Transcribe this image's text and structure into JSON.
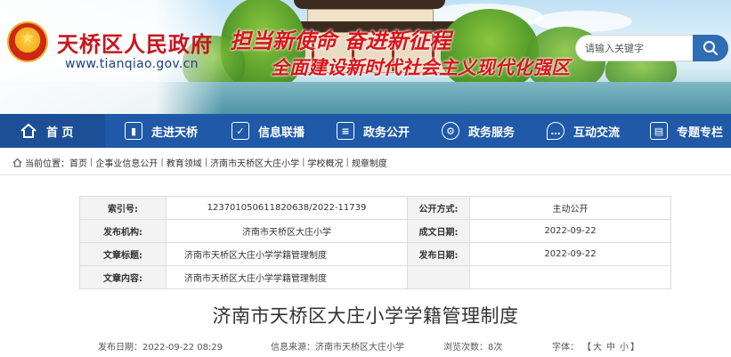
{
  "header": {
    "site_title": "天桥区人民政府",
    "site_url": "www.tianqiao.gov.cn",
    "slogan_line1": "担当新使命  奋进新征程",
    "slogan_line2": "全面建设新时代社会主义现代化强区",
    "search_placeholder": "请输入关键字"
  },
  "nav": {
    "items": [
      {
        "label": "首  页",
        "icon": "home-icon"
      },
      {
        "label": "走进天桥",
        "icon": "bookmark-icon"
      },
      {
        "label": "信息联播",
        "icon": "broadcast-icon"
      },
      {
        "label": "政务公开",
        "icon": "document-icon"
      },
      {
        "label": "政务服务",
        "icon": "service-icon"
      },
      {
        "label": "互动交流",
        "icon": "chat-icon"
      },
      {
        "label": "专题专栏",
        "icon": "topic-icon"
      }
    ]
  },
  "breadcrumb": {
    "prefix": "当前位置：",
    "items": [
      "首页",
      "企事业信息公开",
      "教育领域",
      "济南市天桥区大庄小学",
      "学校概况",
      "规章制度"
    ]
  },
  "info_table": {
    "index_label": "索引号:",
    "index_value": "123701050611820638/2022-11739",
    "open_mode_label": "公开方式:",
    "open_mode_value": "主动公开",
    "publisher_label": "发布机构:",
    "publisher_value": "济南市天桥区大庄小学",
    "created_label": "成文日期:",
    "created_value": "2022-09-22",
    "article_title_label": "文章标题:",
    "article_title_value": "济南市天桥区大庄小学学籍管理制度",
    "published_label": "发布日期:",
    "published_value": "2022-09-22",
    "article_content_label": "文章内容:",
    "article_content_value": "济南市天桥区大庄小学学籍管理制度"
  },
  "article": {
    "title": "济南市天桥区大庄小学学籍管理制度",
    "publish_date": "发布日期：2022-09-22 08:29",
    "source": "信息来源：济南市天桥区大庄小学",
    "views": "浏览次数：8次",
    "font_size_label": "字体：",
    "font_large": "大",
    "font_medium": "中",
    "font_small": "小"
  },
  "colors": {
    "nav_bg": "#1f59a8",
    "title_red": "#c8161d",
    "search_button": "#2f6db5"
  }
}
